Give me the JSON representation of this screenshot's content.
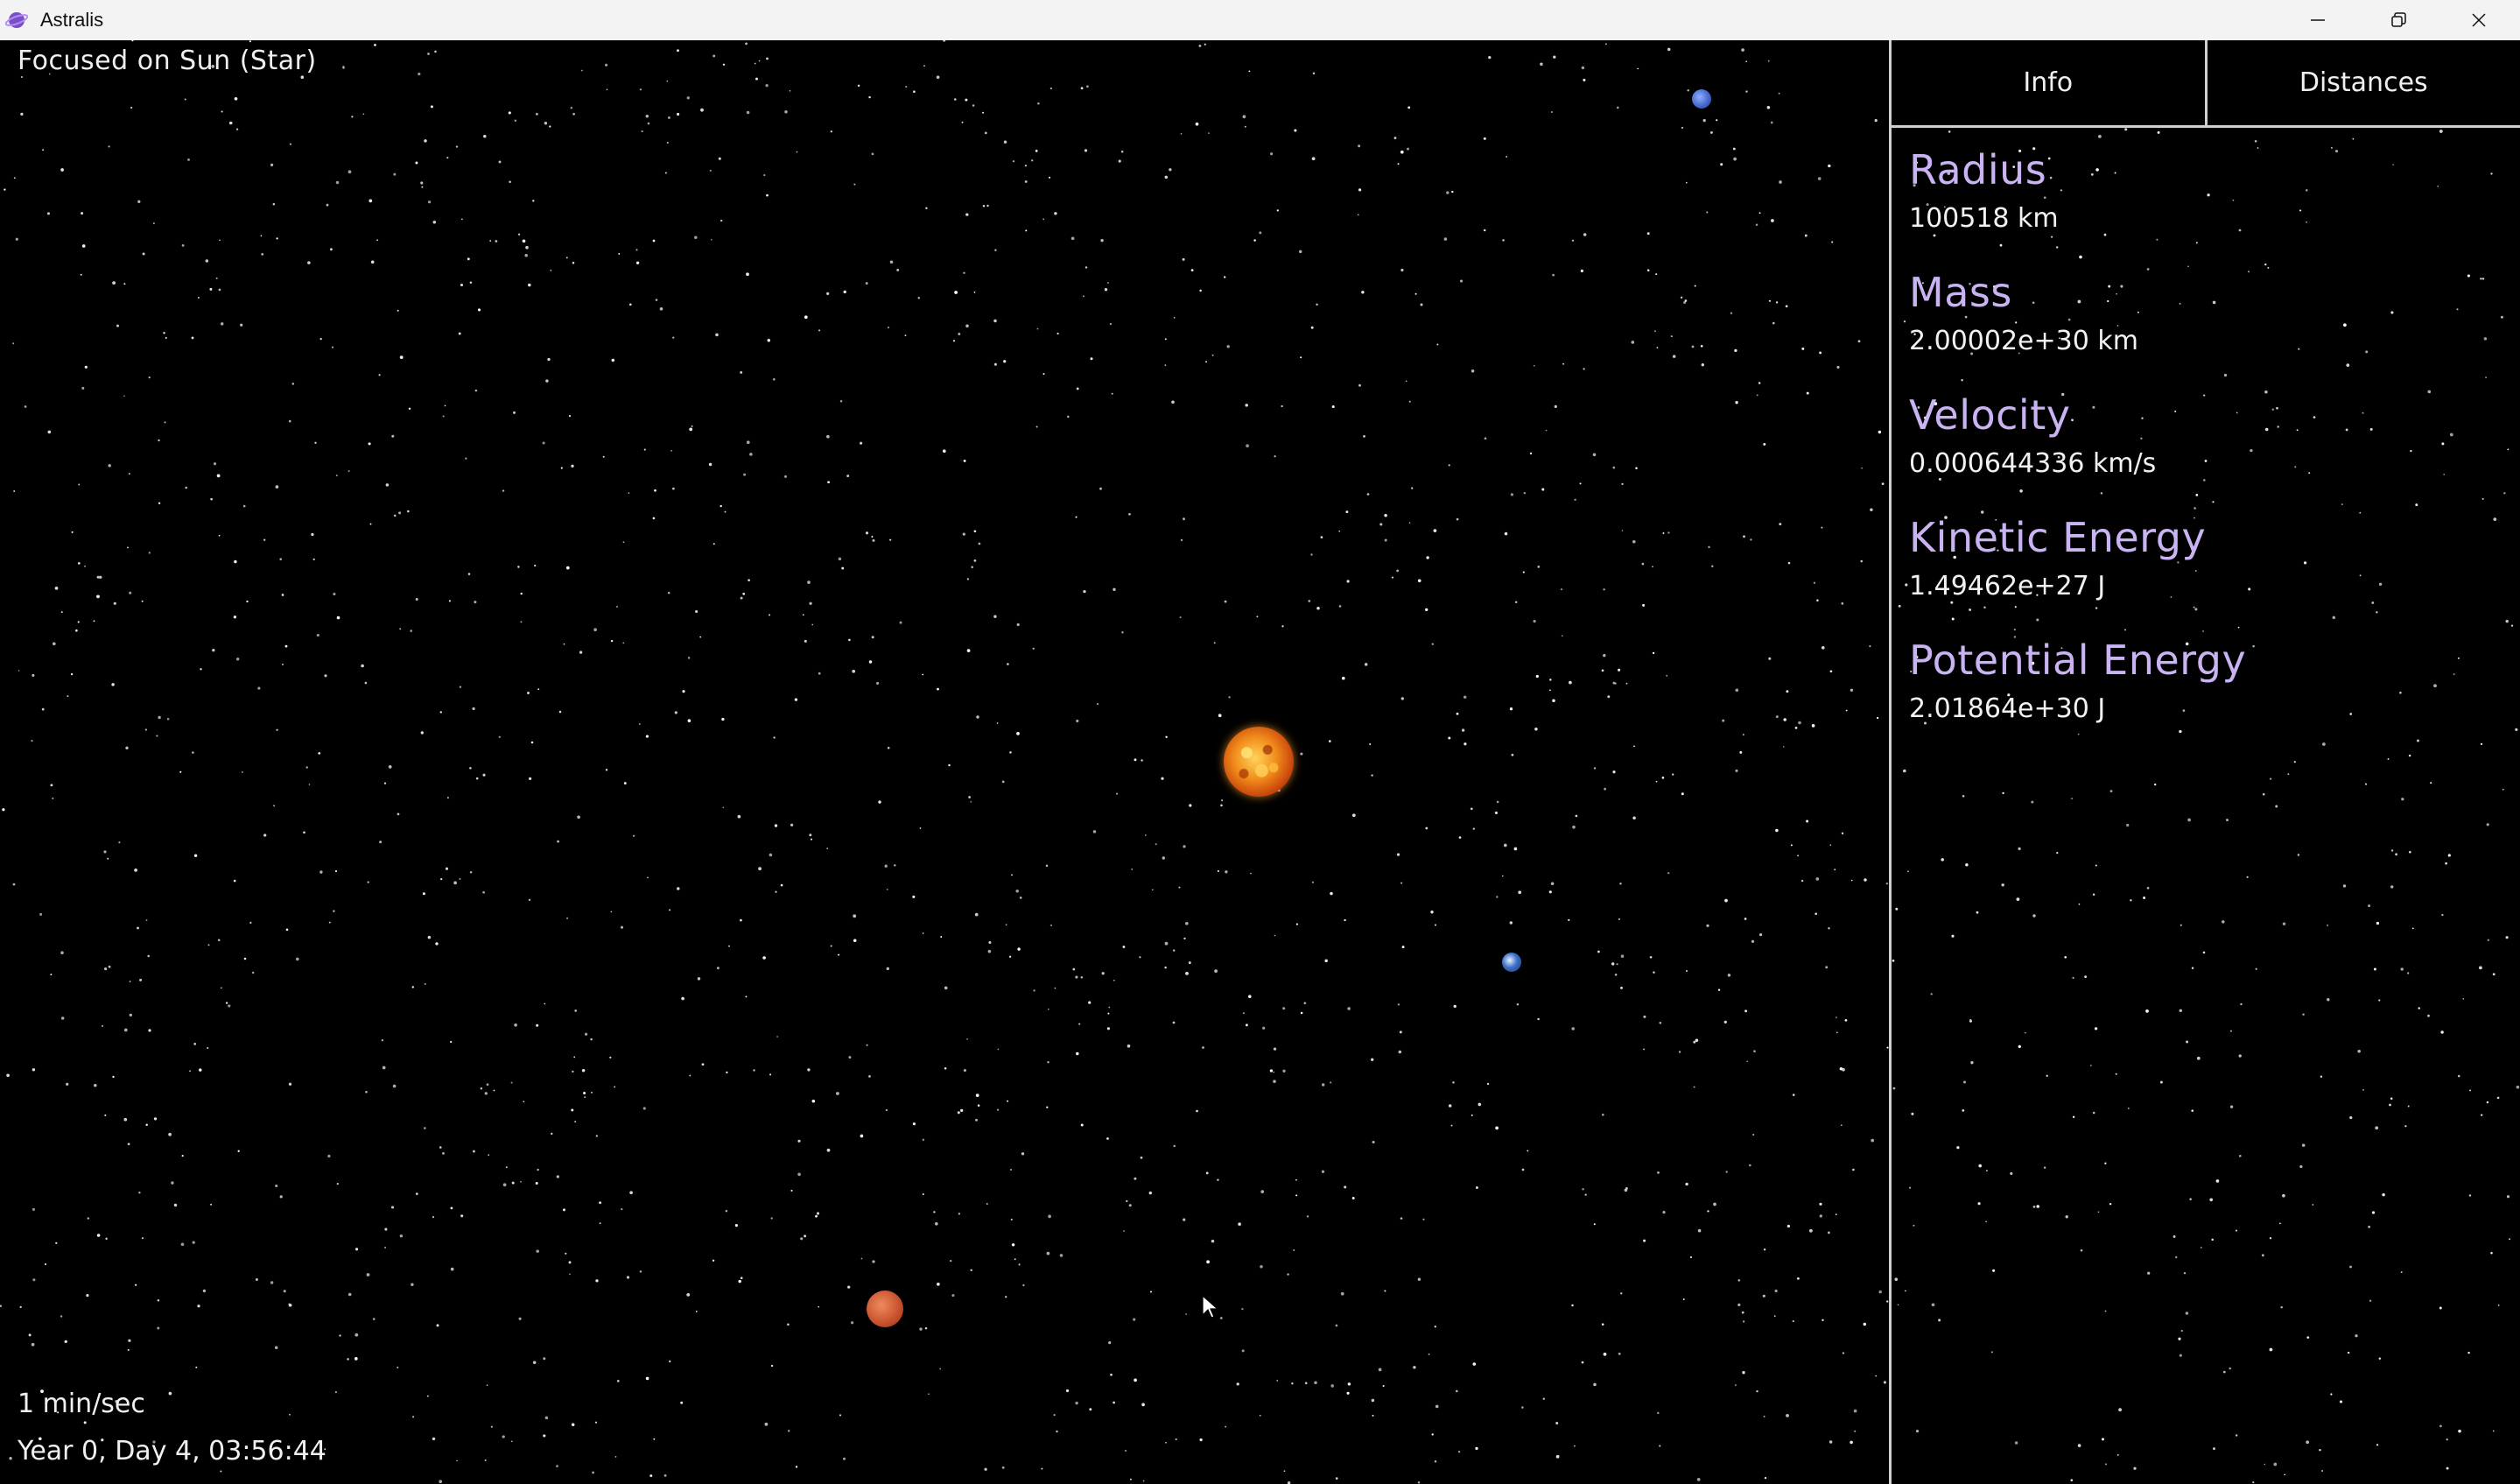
{
  "window": {
    "title": "Astralis",
    "controls": {
      "minimize_icon": "minimize-icon",
      "maximize_icon": "restore-icon",
      "close_icon": "close-icon"
    }
  },
  "viewport": {
    "focus_label": "Focused on Sun (Star)",
    "sim_speed": "1 min/sec",
    "sim_time": "Year 0, Day 4, 03:56:44",
    "bodies": [
      "sun",
      "earth",
      "neptune",
      "mars"
    ]
  },
  "panel": {
    "tabs": [
      {
        "label": "Info"
      },
      {
        "label": "Distances"
      }
    ],
    "properties": [
      {
        "label": "Radius",
        "value": "100518 km"
      },
      {
        "label": "Mass",
        "value": "2.00002e+30 km"
      },
      {
        "label": "Velocity",
        "value": "0.000644336 km/s"
      },
      {
        "label": "Kinetic Energy",
        "value": "1.49462e+27 J"
      },
      {
        "label": "Potential Energy",
        "value": "2.01864e+30 J"
      }
    ]
  },
  "colors": {
    "background": "#000000",
    "property_label": "#c9b3f2",
    "text": "#f0f0f0",
    "divider": "#cfcfcf"
  }
}
